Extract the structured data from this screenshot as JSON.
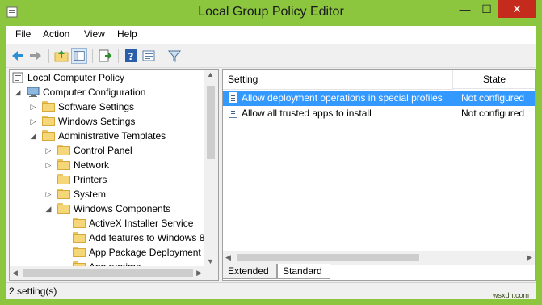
{
  "window": {
    "title": "Local Group Policy Editor",
    "minimize_glyph": "—",
    "maximize_glyph": "☐",
    "close_glyph": "✕",
    "frame_color": "#8cc63e",
    "close_color": "#c42b1c"
  },
  "menubar": {
    "items": [
      "File",
      "Action",
      "View",
      "Help"
    ]
  },
  "toolbar": {
    "buttons": [
      "back-icon",
      "forward-icon",
      "up-folder-icon",
      "show-hide-tree-icon",
      "export-list-icon",
      "help-icon",
      "extended-view-icon",
      "filter-icon"
    ]
  },
  "tree": {
    "nodes": [
      {
        "label": "Local Computer Policy",
        "expanded": null
      },
      {
        "label": "Computer Configuration",
        "expanded": true
      },
      {
        "label": "Software Settings",
        "expanded": false
      },
      {
        "label": "Windows Settings",
        "expanded": false
      },
      {
        "label": "Administrative Templates",
        "expanded": true
      },
      {
        "label": "Control Panel",
        "expanded": false
      },
      {
        "label": "Network",
        "expanded": false
      },
      {
        "label": "Printers",
        "expanded": null
      },
      {
        "label": "System",
        "expanded": false
      },
      {
        "label": "Windows Components",
        "expanded": true
      },
      {
        "label": "ActiveX Installer Service",
        "expanded": null
      },
      {
        "label": "Add features to Windows 8",
        "expanded": null
      },
      {
        "label": "App Package Deployment",
        "expanded": null
      },
      {
        "label": "App runtime",
        "expanded": null
      }
    ]
  },
  "list": {
    "columns": {
      "setting": "Setting",
      "state": "State"
    },
    "rows": [
      {
        "setting": "Allow deployment operations in special profiles",
        "state": "Not configured",
        "selected": true
      },
      {
        "setting": "Allow all trusted apps to install",
        "state": "Not configured",
        "selected": false
      }
    ],
    "selection_color": "#3399ff"
  },
  "tabs": [
    {
      "label": "Extended",
      "active": false
    },
    {
      "label": "Standard",
      "active": true
    }
  ],
  "status": {
    "text": "2 setting(s)"
  },
  "watermark": "wsxdn.com"
}
